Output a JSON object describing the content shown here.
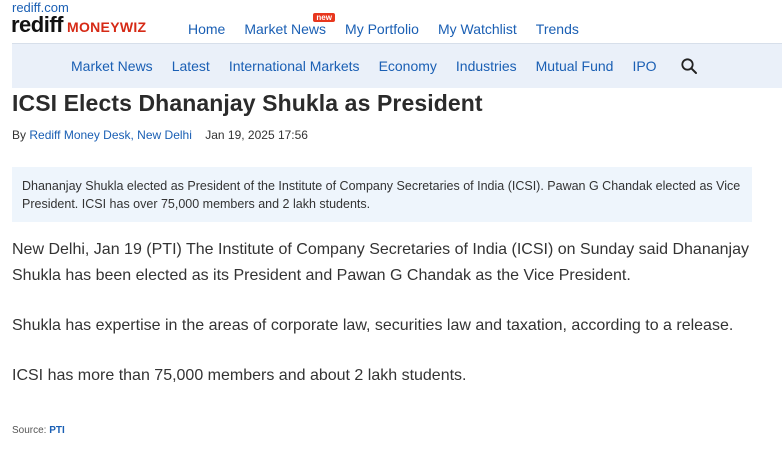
{
  "site": {
    "top_link": "rediff.com",
    "logo_primary": "rediff",
    "logo_secondary": "MONEYWIZ"
  },
  "main_nav": {
    "items": [
      "Home",
      "Market News",
      "My Portfolio",
      "My Watchlist",
      "Trends"
    ],
    "new_badge": "new"
  },
  "sub_nav": {
    "items": [
      "Market News",
      "Latest",
      "International Markets",
      "Economy",
      "Industries",
      "Mutual Fund",
      "IPO"
    ]
  },
  "article": {
    "title": "ICSI Elects Dhananjay Shukla as President",
    "byline_prefix": "By",
    "author": "Rediff Money Desk, New Delhi",
    "date": "Jan 19, 2025 17:56",
    "summary": "Dhananjay Shukla elected as President of the Institute of Company Secretaries of India (ICSI). Pawan G Chandak elected as Vice President. ICSI has over 75,000 members and 2 lakh students.",
    "paragraphs": [
      "New Delhi, Jan 19 (PTI) The Institute of Company Secretaries of India (ICSI) on Sunday said Dhananjay Shukla has been elected as its President and Pawan G Chandak as the Vice President.",
      "Shukla has expertise in the areas of corporate law, securities law and taxation, according to a release.",
      "ICSI has more than 75,000 members and about 2 lakh students."
    ],
    "source_label": "Source:",
    "source_name": "PTI"
  },
  "colors": {
    "link": "#1a5fb4",
    "brand_red": "#d62a16",
    "subnav_bg": "#eaf0f9",
    "summary_bg": "#eef5fc"
  },
  "icons": {
    "search": "search-icon"
  }
}
